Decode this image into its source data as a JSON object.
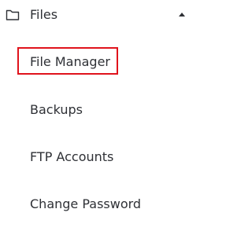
{
  "group": {
    "label": "Files",
    "icon": "folder-icon",
    "expanded": true
  },
  "items": [
    {
      "label": "File Manager",
      "highlighted": true
    },
    {
      "label": "Backups",
      "highlighted": false
    },
    {
      "label": "FTP Accounts",
      "highlighted": false
    },
    {
      "label": "Change Password",
      "highlighted": false
    }
  ],
  "colors": {
    "text": "#2f3136",
    "highlight_border": "#e0131c",
    "background": "#ffffff"
  }
}
